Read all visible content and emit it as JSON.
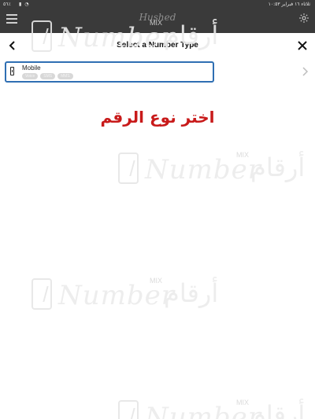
{
  "status_bar": {
    "time_text": "١٠:٥٣",
    "date_text": "ثلاثاء ١٦ فبراير",
    "battery_text": "٥٦٪"
  },
  "app_header": {
    "logo_text": "Hushed"
  },
  "sheet": {
    "title": "Select a Number Type",
    "options": [
      {
        "label": "Mobile",
        "tags": [
          "Voice",
          "SMS",
          "MMS"
        ]
      }
    ]
  },
  "caption": "اختر نوع الرقم",
  "watermark": {
    "word": "Number",
    "mix": "MIX",
    "arabic": "أرقام"
  },
  "colors": {
    "accent_border": "#2f6fb3",
    "caption_red": "#c81a1a",
    "header_bg": "#3a3a3a"
  }
}
